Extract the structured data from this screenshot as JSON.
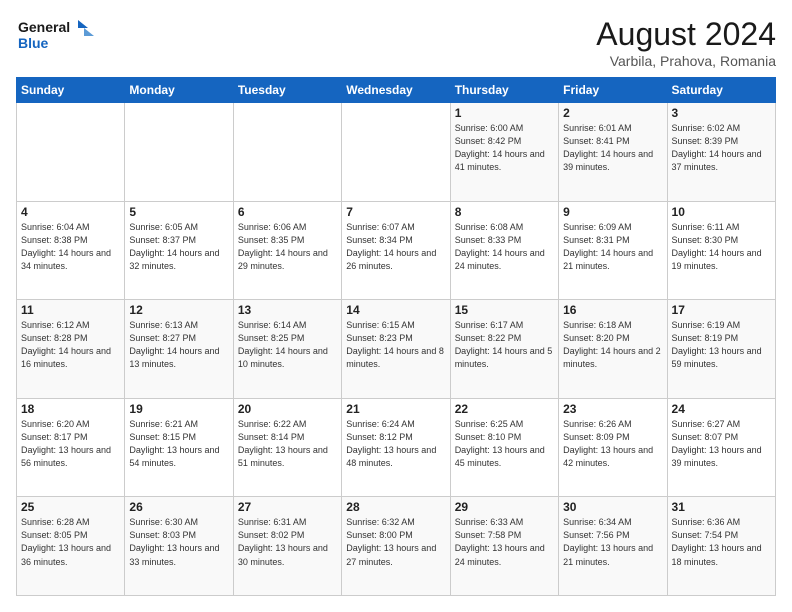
{
  "logo": {
    "text_general": "General",
    "text_blue": "Blue"
  },
  "header": {
    "title": "August 2024",
    "subtitle": "Varbila, Prahova, Romania"
  },
  "weekdays": [
    "Sunday",
    "Monday",
    "Tuesday",
    "Wednesday",
    "Thursday",
    "Friday",
    "Saturday"
  ],
  "weeks": [
    [
      {
        "day": "",
        "info": ""
      },
      {
        "day": "",
        "info": ""
      },
      {
        "day": "",
        "info": ""
      },
      {
        "day": "",
        "info": ""
      },
      {
        "day": "1",
        "info": "Sunrise: 6:00 AM\nSunset: 8:42 PM\nDaylight: 14 hours\nand 41 minutes."
      },
      {
        "day": "2",
        "info": "Sunrise: 6:01 AM\nSunset: 8:41 PM\nDaylight: 14 hours\nand 39 minutes."
      },
      {
        "day": "3",
        "info": "Sunrise: 6:02 AM\nSunset: 8:39 PM\nDaylight: 14 hours\nand 37 minutes."
      }
    ],
    [
      {
        "day": "4",
        "info": "Sunrise: 6:04 AM\nSunset: 8:38 PM\nDaylight: 14 hours\nand 34 minutes."
      },
      {
        "day": "5",
        "info": "Sunrise: 6:05 AM\nSunset: 8:37 PM\nDaylight: 14 hours\nand 32 minutes."
      },
      {
        "day": "6",
        "info": "Sunrise: 6:06 AM\nSunset: 8:35 PM\nDaylight: 14 hours\nand 29 minutes."
      },
      {
        "day": "7",
        "info": "Sunrise: 6:07 AM\nSunset: 8:34 PM\nDaylight: 14 hours\nand 26 minutes."
      },
      {
        "day": "8",
        "info": "Sunrise: 6:08 AM\nSunset: 8:33 PM\nDaylight: 14 hours\nand 24 minutes."
      },
      {
        "day": "9",
        "info": "Sunrise: 6:09 AM\nSunset: 8:31 PM\nDaylight: 14 hours\nand 21 minutes."
      },
      {
        "day": "10",
        "info": "Sunrise: 6:11 AM\nSunset: 8:30 PM\nDaylight: 14 hours\nand 19 minutes."
      }
    ],
    [
      {
        "day": "11",
        "info": "Sunrise: 6:12 AM\nSunset: 8:28 PM\nDaylight: 14 hours\nand 16 minutes."
      },
      {
        "day": "12",
        "info": "Sunrise: 6:13 AM\nSunset: 8:27 PM\nDaylight: 14 hours\nand 13 minutes."
      },
      {
        "day": "13",
        "info": "Sunrise: 6:14 AM\nSunset: 8:25 PM\nDaylight: 14 hours\nand 10 minutes."
      },
      {
        "day": "14",
        "info": "Sunrise: 6:15 AM\nSunset: 8:23 PM\nDaylight: 14 hours\nand 8 minutes."
      },
      {
        "day": "15",
        "info": "Sunrise: 6:17 AM\nSunset: 8:22 PM\nDaylight: 14 hours\nand 5 minutes."
      },
      {
        "day": "16",
        "info": "Sunrise: 6:18 AM\nSunset: 8:20 PM\nDaylight: 14 hours\nand 2 minutes."
      },
      {
        "day": "17",
        "info": "Sunrise: 6:19 AM\nSunset: 8:19 PM\nDaylight: 13 hours\nand 59 minutes."
      }
    ],
    [
      {
        "day": "18",
        "info": "Sunrise: 6:20 AM\nSunset: 8:17 PM\nDaylight: 13 hours\nand 56 minutes."
      },
      {
        "day": "19",
        "info": "Sunrise: 6:21 AM\nSunset: 8:15 PM\nDaylight: 13 hours\nand 54 minutes."
      },
      {
        "day": "20",
        "info": "Sunrise: 6:22 AM\nSunset: 8:14 PM\nDaylight: 13 hours\nand 51 minutes."
      },
      {
        "day": "21",
        "info": "Sunrise: 6:24 AM\nSunset: 8:12 PM\nDaylight: 13 hours\nand 48 minutes."
      },
      {
        "day": "22",
        "info": "Sunrise: 6:25 AM\nSunset: 8:10 PM\nDaylight: 13 hours\nand 45 minutes."
      },
      {
        "day": "23",
        "info": "Sunrise: 6:26 AM\nSunset: 8:09 PM\nDaylight: 13 hours\nand 42 minutes."
      },
      {
        "day": "24",
        "info": "Sunrise: 6:27 AM\nSunset: 8:07 PM\nDaylight: 13 hours\nand 39 minutes."
      }
    ],
    [
      {
        "day": "25",
        "info": "Sunrise: 6:28 AM\nSunset: 8:05 PM\nDaylight: 13 hours\nand 36 minutes."
      },
      {
        "day": "26",
        "info": "Sunrise: 6:30 AM\nSunset: 8:03 PM\nDaylight: 13 hours\nand 33 minutes."
      },
      {
        "day": "27",
        "info": "Sunrise: 6:31 AM\nSunset: 8:02 PM\nDaylight: 13 hours\nand 30 minutes."
      },
      {
        "day": "28",
        "info": "Sunrise: 6:32 AM\nSunset: 8:00 PM\nDaylight: 13 hours\nand 27 minutes."
      },
      {
        "day": "29",
        "info": "Sunrise: 6:33 AM\nSunset: 7:58 PM\nDaylight: 13 hours\nand 24 minutes."
      },
      {
        "day": "30",
        "info": "Sunrise: 6:34 AM\nSunset: 7:56 PM\nDaylight: 13 hours\nand 21 minutes."
      },
      {
        "day": "31",
        "info": "Sunrise: 6:36 AM\nSunset: 7:54 PM\nDaylight: 13 hours\nand 18 minutes."
      }
    ]
  ]
}
